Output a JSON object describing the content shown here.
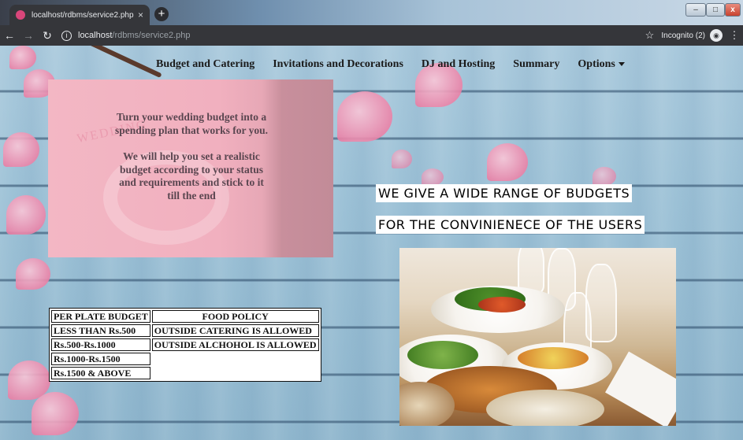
{
  "browser": {
    "tab_title": "localhost/rdbms/service2.php",
    "tab_close": "×",
    "new_tab": "+",
    "url_host": "localhost",
    "url_path": "/rdbms/service2.php",
    "incognito_label": "Incognito (2)",
    "win_close": "x"
  },
  "nav": {
    "items": [
      "Budget and Catering",
      "Invitations and Decorations",
      "DJ and Hosting",
      "Summary",
      "Options"
    ]
  },
  "card": {
    "para1": "Turn your wedding budget into a spending plan that works for you.",
    "para2": "We will help you set a realistic budget according to your status and requirements and stick to it till the end",
    "ghost_word": "WEDDING"
  },
  "headings": {
    "line1": "WE GIVE A WIDE RANGE OF BUDGETS",
    "line2": "FOR THE CONVINIENECE OF THE USERS"
  },
  "table": {
    "headers": [
      "PER PLATE BUDGET",
      "FOOD POLICY"
    ],
    "rows": [
      [
        "LESS THAN Rs.500",
        "OUTSIDE CATERING IS ALLOWED"
      ],
      [
        "Rs.500-Rs.1000",
        "OUTSIDE ALCHOHOL IS ALLOWED"
      ],
      [
        "Rs.1000-Rs.1500",
        ""
      ],
      [
        "Rs.1500 & ABOVE",
        ""
      ]
    ]
  },
  "colors": {
    "card_pink": "#f1b0bf",
    "wood_blue": "#9cc1d6",
    "chrome_dark": "#35363a"
  }
}
